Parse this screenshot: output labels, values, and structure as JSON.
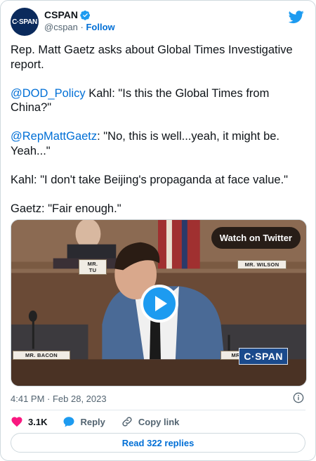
{
  "author": {
    "display_name": "CSPAN",
    "handle": "@cspan",
    "separator": "·",
    "follow_label": "Follow",
    "avatar_text": "C·SPAN"
  },
  "tweet": {
    "line1": "Rep. Matt Gaetz asks about Global Times Investigative report.",
    "mention1": "@DOD_Policy",
    "line2": " Kahl: \"Is this the Global Times from China?\"",
    "mention2": "@RepMattGaetz",
    "line3": ": \"No, this is well...yeah, it might be. Yeah...\"",
    "line4": "Kahl: \"I don't take Beijing's propaganda at face value.\"",
    "line5": "Gaetz: \"Fair enough.\""
  },
  "video": {
    "watch_label": "Watch on Twitter",
    "nameplates": {
      "bacon": "MR. BACON",
      "wilson": "MR. WILSON",
      "gaetz": "MR. GA",
      "top_left": "MR. TU"
    },
    "logo_text": "C·SPAN"
  },
  "meta": {
    "timestamp": "4:41 PM · Feb 28, 2023"
  },
  "actions": {
    "likes": "3.1K",
    "reply_label": "Reply",
    "copy_label": "Copy link"
  },
  "replies_button": "Read 322 replies",
  "colors": {
    "accent": "#1d9bf0",
    "link": "#006fd6",
    "like": "#f91880"
  }
}
